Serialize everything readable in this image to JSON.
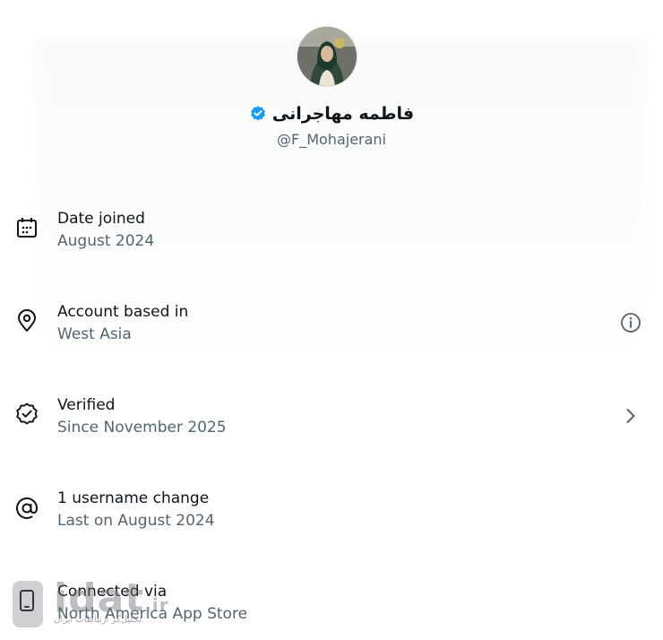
{
  "profile": {
    "display_name": "فاطمه مهاجرانی",
    "handle": "@F_Mohajerani",
    "verified_color": "#1d9bf0"
  },
  "details": [
    {
      "icon": "calendar-icon",
      "title": "Date joined",
      "subtitle": "August 2024",
      "trailing": ""
    },
    {
      "icon": "location-pin-icon",
      "title": "Account based in",
      "subtitle": "West Asia",
      "trailing": "info-icon"
    },
    {
      "icon": "verified-check-icon",
      "title": "Verified",
      "subtitle": "Since November 2025",
      "trailing": "chevron-right-icon"
    },
    {
      "icon": "at-sign-icon",
      "title": "1 username change",
      "subtitle": "Last on August 2024",
      "trailing": ""
    },
    {
      "icon": "phone-icon",
      "title": "Connected via",
      "subtitle": "North America App Store",
      "trailing": ""
    }
  ],
  "watermark": {
    "brand": "idat",
    "domain": ".ir",
    "tagline": "تحلیل‌گر ارتباطات ایران"
  }
}
